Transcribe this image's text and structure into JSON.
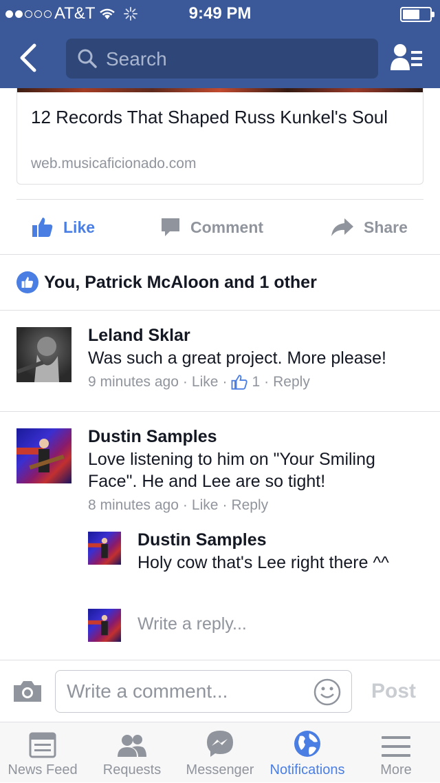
{
  "status_bar": {
    "carrier": "AT&T",
    "time": "9:49 PM",
    "signal_bars": 2,
    "signal_total": 5
  },
  "nav": {
    "search_placeholder": "Search"
  },
  "link_card": {
    "title": "12 Records That Shaped Russ Kunkel's Soul",
    "domain": "web.musicaficionado.com"
  },
  "actions": {
    "like": "Like",
    "comment": "Comment",
    "share": "Share"
  },
  "likes_summary": "You, Patrick McAloon and 1 other",
  "comments": [
    {
      "name": "Leland Sklar",
      "text": "Was such a great project. More please!",
      "time": "9 minutes ago",
      "like": "Like",
      "like_count": "1",
      "reply": "Reply"
    },
    {
      "name": "Dustin Samples",
      "text": "Love listening to him on \"Your Smiling Face\". He and Lee are so tight!",
      "time": "8 minutes ago",
      "like": "Like",
      "reply": "Reply",
      "replies": [
        {
          "name": "Dustin Samples",
          "text": "Holy cow that's Lee right there ^^"
        }
      ]
    }
  ],
  "reply_placeholder": "Write a reply...",
  "composer": {
    "placeholder": "Write a comment...",
    "post": "Post"
  },
  "tabs": [
    {
      "label": "News Feed",
      "icon": "news-feed-icon"
    },
    {
      "label": "Requests",
      "icon": "friend-requests-icon"
    },
    {
      "label": "Messenger",
      "icon": "messenger-icon"
    },
    {
      "label": "Notifications",
      "icon": "globe-icon",
      "active": true
    },
    {
      "label": "More",
      "icon": "menu-icon"
    }
  ],
  "colors": {
    "header": "#3b5998",
    "accent": "#4a7ee3",
    "muted": "#90949c"
  }
}
